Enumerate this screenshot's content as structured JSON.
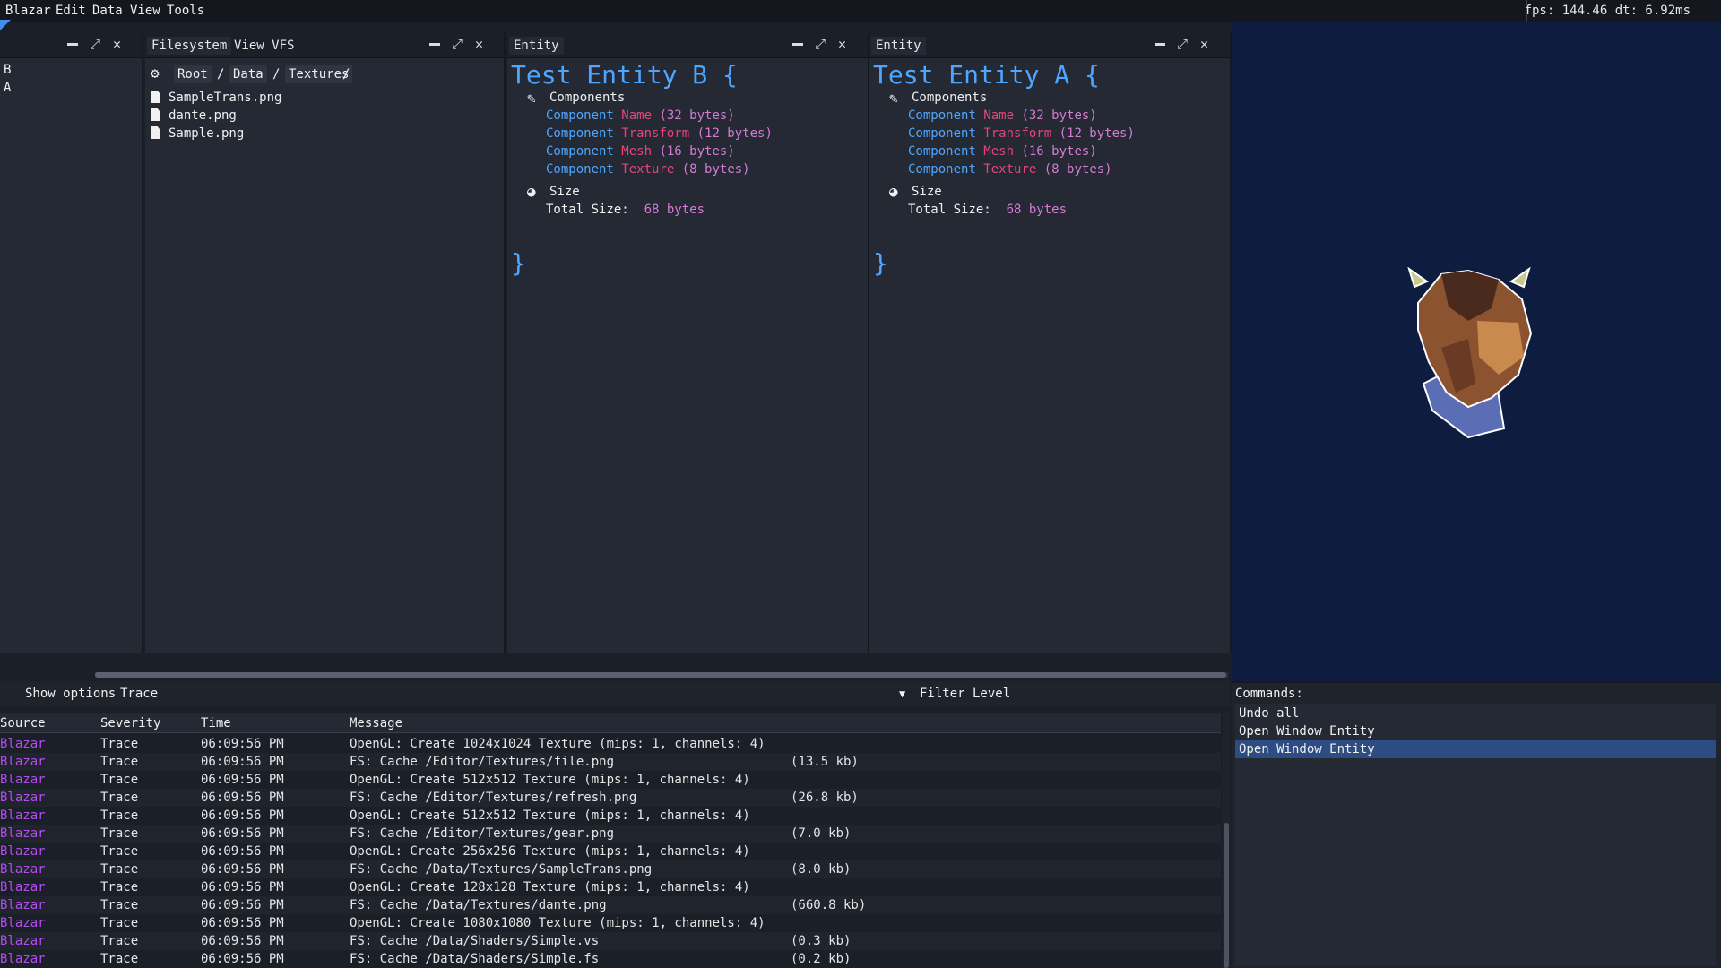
{
  "menubar": {
    "items": [
      "Blazar",
      "Edit",
      "Data",
      "View",
      "Tools"
    ],
    "fps_label": "fps: 144.46 dt: 6.92ms"
  },
  "outliner": {
    "items": [
      "B",
      "A"
    ]
  },
  "filesystem": {
    "tabs": [
      "Filesystem",
      "View VFS"
    ],
    "breadcrumb": [
      "Root",
      "Data",
      "Textures"
    ],
    "separator": "/",
    "files": [
      "SampleTrans.png",
      "dante.png",
      "Sample.png"
    ]
  },
  "entity_b": {
    "tab": "Entity",
    "title": "Test Entity B {",
    "close": "}",
    "components_label": "Components",
    "size_label": "Size",
    "components": [
      {
        "kw": "Component",
        "name": "Name",
        "size": "(32 bytes)"
      },
      {
        "kw": "Component",
        "name": "Transform",
        "size": "(12 bytes)"
      },
      {
        "kw": "Component",
        "name": "Mesh",
        "size": "(16 bytes)"
      },
      {
        "kw": "Component",
        "name": "Texture",
        "size": "(8 bytes)"
      }
    ],
    "total_label": "Total Size:",
    "total_value": "68 bytes"
  },
  "entity_a": {
    "tab": "Entity",
    "title": "Test Entity A {",
    "close": "}",
    "components_label": "Components",
    "size_label": "Size",
    "components": [
      {
        "kw": "Component",
        "name": "Name",
        "size": "(32 bytes)"
      },
      {
        "kw": "Component",
        "name": "Transform",
        "size": "(12 bytes)"
      },
      {
        "kw": "Component",
        "name": "Mesh",
        "size": "(16 bytes)"
      },
      {
        "kw": "Component",
        "name": "Texture",
        "size": "(8 bytes)"
      }
    ],
    "total_label": "Total Size:",
    "total_value": "68 bytes"
  },
  "log": {
    "show_options": "Show options",
    "level": "Trace",
    "filter_label": "Filter Level",
    "columns": [
      "Source",
      "Severity",
      "Time",
      "Message"
    ],
    "rows": [
      {
        "src": "Blazar",
        "sev": "Trace",
        "time": "06:09:56 PM",
        "msg": "OpenGL: Create 1024x1024 Texture (mips: 1, channels: 4)",
        "size": ""
      },
      {
        "src": "Blazar",
        "sev": "Trace",
        "time": "06:09:56 PM",
        "msg": "FS: Cache /Editor/Textures/file.png",
        "size": "(13.5 kb)"
      },
      {
        "src": "Blazar",
        "sev": "Trace",
        "time": "06:09:56 PM",
        "msg": "OpenGL: Create 512x512 Texture (mips: 1, channels: 4)",
        "size": ""
      },
      {
        "src": "Blazar",
        "sev": "Trace",
        "time": "06:09:56 PM",
        "msg": "FS: Cache /Editor/Textures/refresh.png",
        "size": "(26.8 kb)"
      },
      {
        "src": "Blazar",
        "sev": "Trace",
        "time": "06:09:56 PM",
        "msg": "OpenGL: Create 512x512 Texture (mips: 1, channels: 4)",
        "size": ""
      },
      {
        "src": "Blazar",
        "sev": "Trace",
        "time": "06:09:56 PM",
        "msg": "FS: Cache /Editor/Textures/gear.png",
        "size": "(7.0 kb)"
      },
      {
        "src": "Blazar",
        "sev": "Trace",
        "time": "06:09:56 PM",
        "msg": "OpenGL: Create 256x256 Texture (mips: 1, channels: 4)",
        "size": ""
      },
      {
        "src": "Blazar",
        "sev": "Trace",
        "time": "06:09:56 PM",
        "msg": "FS: Cache /Data/Textures/SampleTrans.png",
        "size": "(8.0 kb)"
      },
      {
        "src": "Blazar",
        "sev": "Trace",
        "time": "06:09:56 PM",
        "msg": "OpenGL: Create 128x128 Texture (mips: 1, channels: 4)",
        "size": ""
      },
      {
        "src": "Blazar",
        "sev": "Trace",
        "time": "06:09:56 PM",
        "msg": "FS: Cache /Data/Textures/dante.png",
        "size": "(660.8 kb)"
      },
      {
        "src": "Blazar",
        "sev": "Trace",
        "time": "06:09:56 PM",
        "msg": "OpenGL: Create 1080x1080 Texture (mips: 1, channels: 4)",
        "size": ""
      },
      {
        "src": "Blazar",
        "sev": "Trace",
        "time": "06:09:56 PM",
        "msg": "FS: Cache /Data/Shaders/Simple.vs",
        "size": "(0.3 kb)"
      },
      {
        "src": "Blazar",
        "sev": "Trace",
        "time": "06:09:56 PM",
        "msg": "FS: Cache /Data/Shaders/Simple.fs",
        "size": "(0.2 kb)"
      }
    ]
  },
  "commands": {
    "title": "Commands:",
    "items": [
      "Undo all",
      "Open Window Entity",
      "Open Window Entity"
    ],
    "selected_index": 2
  },
  "colors": {
    "accent": "#4ea6ff",
    "component_name": "#e8447a",
    "size_value": "#d67bd4",
    "log_source": "#b44cf0",
    "viewport_bg": "#0d1c3f",
    "selection": "#2d4c82"
  }
}
